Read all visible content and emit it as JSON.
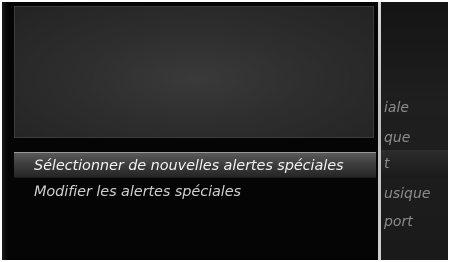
{
  "background_menu": {
    "items": [
      {
        "label": "iale"
      },
      {
        "label": "que"
      },
      {
        "label": "t"
      },
      {
        "label": "usique"
      },
      {
        "label": "port"
      }
    ]
  },
  "popup": {
    "options": [
      {
        "label": "Sélectionner de nouvelles alertes spéciales",
        "selected": true
      },
      {
        "label": "Modifier les alertes spéciales",
        "selected": false
      }
    ]
  }
}
